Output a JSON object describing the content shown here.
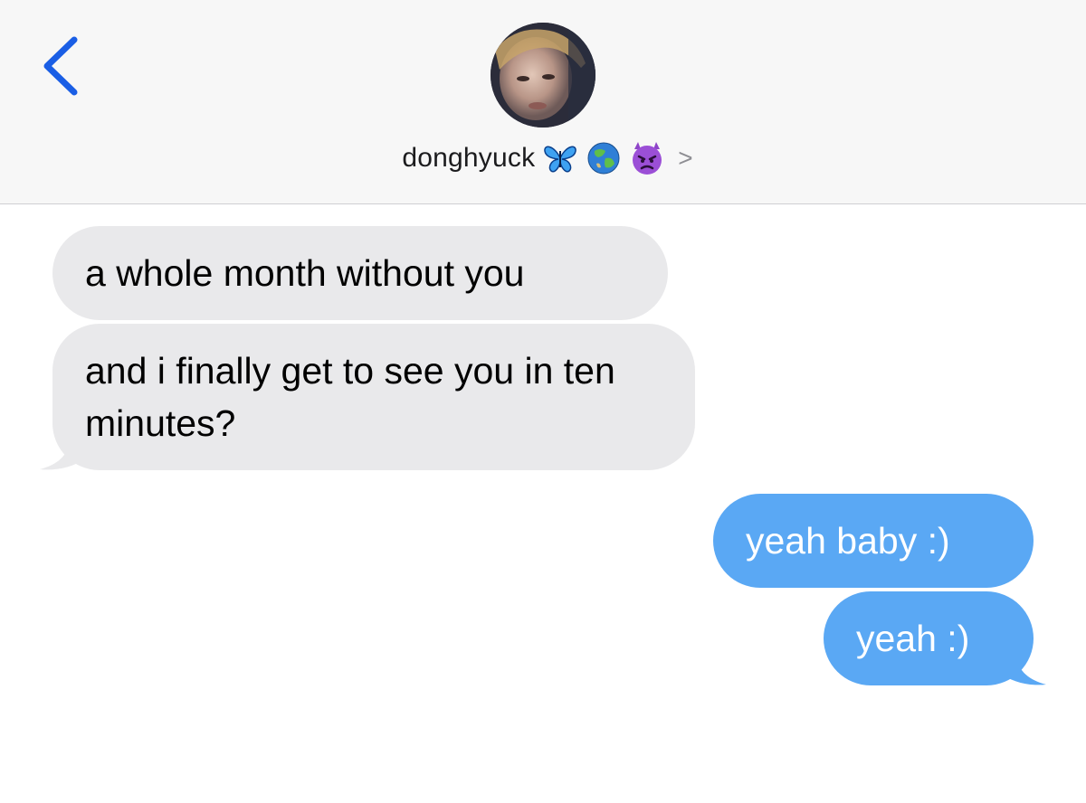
{
  "header": {
    "back_icon": "chevron-left-icon",
    "contact_name": "donghyuck",
    "name_emojis": [
      "butterfly-emoji-icon",
      "globe-emoji-icon",
      "angry-devil-emoji-icon"
    ],
    "detail_chevron": ">"
  },
  "colors": {
    "accent_blue": "#1a5ee5",
    "outgoing_bubble": "#5aa8f4",
    "incoming_bubble": "#e9e9eb",
    "header_bg": "#f7f7f7"
  },
  "messages": [
    {
      "direction": "incoming",
      "text": "a whole month without you"
    },
    {
      "direction": "incoming",
      "text": "and i finally get to see you in ten minutes?"
    },
    {
      "direction": "outgoing",
      "text": "yeah baby :)"
    },
    {
      "direction": "outgoing",
      "text": "yeah :)"
    }
  ]
}
